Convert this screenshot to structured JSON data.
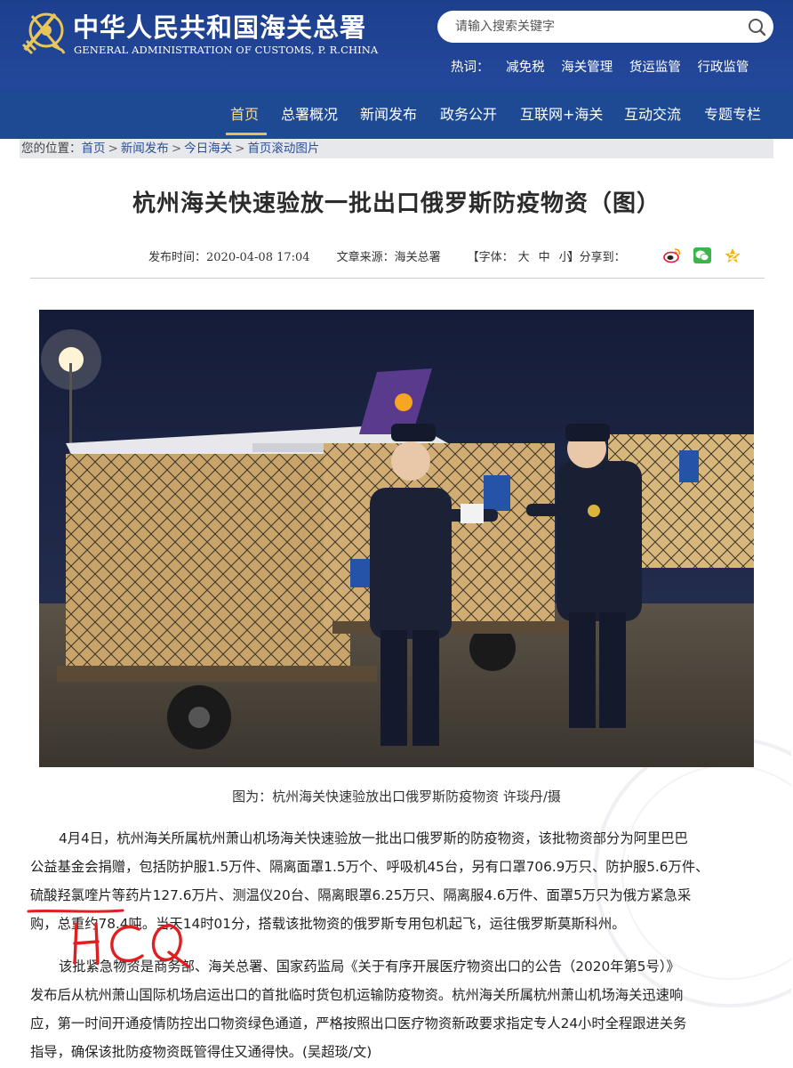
{
  "header": {
    "title_cn": "中华人民共和国海关总署",
    "title_en": "GENERAL ADMINISTRATION OF CUSTOMS, P. R.CHINA",
    "logo_icon": "customs-emblem-icon"
  },
  "search": {
    "placeholder": "请输入搜索关键字",
    "icon": "search-icon"
  },
  "hot": {
    "label": "热词：",
    "items": [
      "减免税",
      "海关管理",
      "货运监管",
      "行政监管"
    ]
  },
  "nav": {
    "items": [
      "首页",
      "总署概况",
      "新闻发布",
      "政务公开",
      "互联网+海关",
      "互动交流",
      "专题专栏"
    ],
    "active_index": 0
  },
  "breadcrumb": {
    "lead": "您的位置：",
    "items": [
      "首页",
      "新闻发布",
      "今日海关",
      "首页滚动图片"
    ],
    "separator": ">"
  },
  "article": {
    "title": "杭州海关快速验放一批出口俄罗斯防疫物资（图）",
    "publish_label": "发布时间：",
    "publish_time": "2020-04-08 17:04",
    "source_label": "文章来源：",
    "source": "海关总署",
    "font_label": "【字体：",
    "font_sizes": [
      "大",
      "中",
      "小"
    ],
    "share_label": "】分享到：",
    "share_icons": [
      "weibo-icon",
      "wechat-icon",
      "qzone-icon"
    ],
    "caption": "图为：杭州海关快速验放出口俄罗斯防疫物资 许琰丹/摄",
    "paragraph1": [
      "4月4日，杭州海关所属杭州萧山机场海关快速验放一批出口俄罗斯的防疫物资，该批物资部分为阿里巴巴",
      "公益基金会捐赠，包括防护服1.5万件、隔离面罩1.5万个、呼吸机45台，另有口罩706.9万只、防护服5.6万件、",
      "硫酸羟氯喹片等药片127.6万片、测温仪20台、隔离眼罩6.25万只、隔离服4.6万件、面罩5万只为俄方紧急采",
      "购，总重约78.4吨。当天14时01分，搭载该批物资的俄罗斯专用包机起飞，运往俄罗斯莫斯科州。"
    ],
    "paragraph2": [
      "该批紧急物资是商务部、海关总署、国家药监局《关于有序开展医疗物资出口的公告（2020年第5号）》",
      "发布后从杭州萧山国际机场启运出口的首批临时货包机运输防疫物资。杭州海关所属杭州萧山机场海关迅速响",
      "应，第一时间开通疫情防控出口物资绿色通道，严格按照出口医疗物资新政要求指定专人24小时全程跟进关务",
      "指导，确保该批防疫物资既管得住又通得快。(吴超琰/文)"
    ]
  },
  "annotation": {
    "handwritten_text": "HCQ",
    "color": "#e02020"
  },
  "colors": {
    "header_bg": "#1d3f8e",
    "nav_bg": "#1e4a93",
    "nav_active": "#ffd98a",
    "link": "#2a4f99"
  }
}
